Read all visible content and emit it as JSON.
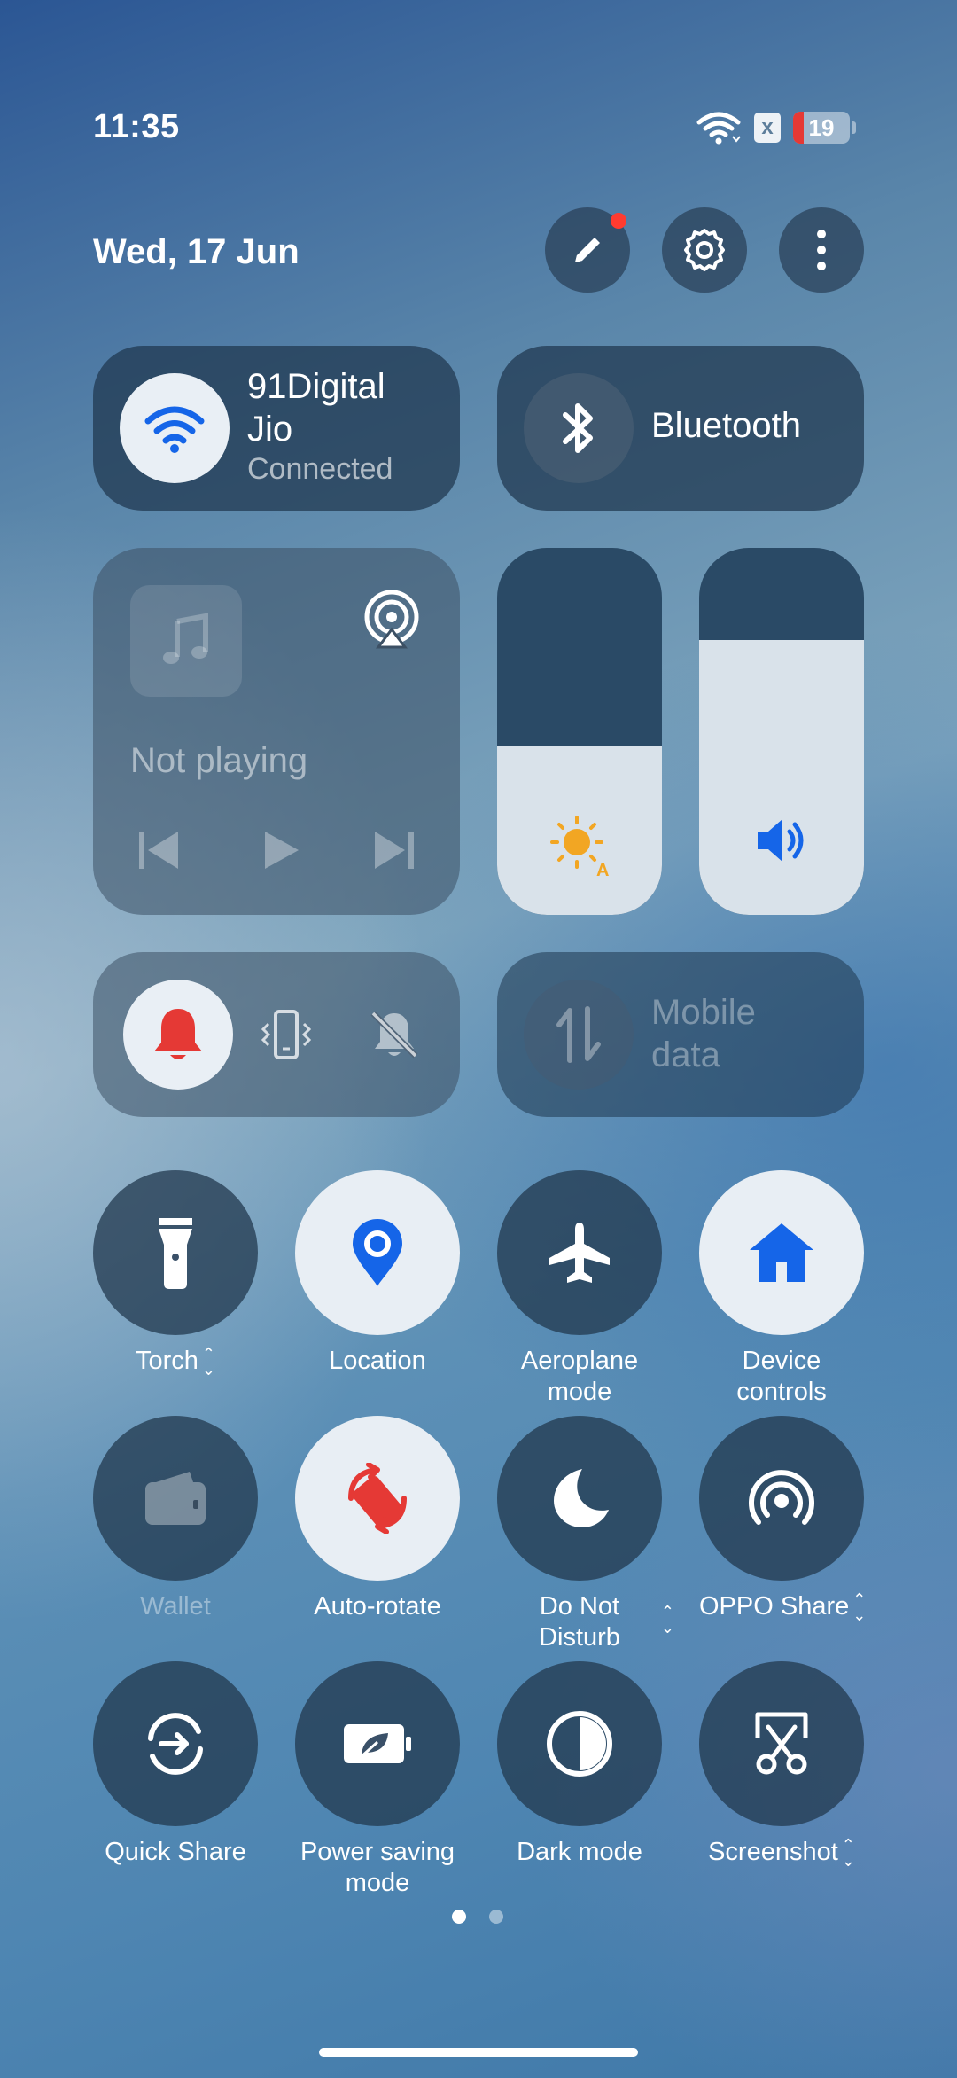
{
  "status_bar": {
    "time": "11:35",
    "battery_level": "19",
    "battery_fraction": 0.19,
    "sim_badge": "x"
  },
  "header": {
    "date": "Wed, 17 Jun"
  },
  "wifi": {
    "network_line1": "91Digital",
    "network_line2": "Jio",
    "status": "Connected"
  },
  "bluetooth": {
    "label": "Bluetooth"
  },
  "media": {
    "status": "Not playing"
  },
  "brightness": {
    "level": 0.46,
    "auto_badge": "A"
  },
  "volume": {
    "level": 0.75
  },
  "mobile_data": {
    "line1": "Mobile",
    "line2": "data"
  },
  "tiles": [
    {
      "label": "Torch",
      "has_chevron": true
    },
    {
      "label": "Location"
    },
    {
      "label_line1": "Aeroplane",
      "label_line2": "mode"
    },
    {
      "label_line1": "Device",
      "label_line2": "controls"
    },
    {
      "label": "Wallet"
    },
    {
      "label": "Auto-rotate"
    },
    {
      "label_line1": "Do Not",
      "label_line2": "Disturb",
      "has_chevron": true
    },
    {
      "label": "OPPO Share",
      "has_chevron": true
    },
    {
      "label": "Quick Share"
    },
    {
      "label_line1": "Power saving",
      "label_line2": "mode"
    },
    {
      "label": "Dark mode"
    },
    {
      "label": "Screenshot",
      "has_chevron": true
    }
  ],
  "colors": {
    "accent_blue": "#1565e8",
    "ring_red": "#e53935",
    "sun_yellow": "#f2a623"
  },
  "pagination": {
    "total": 2,
    "current": 1
  }
}
